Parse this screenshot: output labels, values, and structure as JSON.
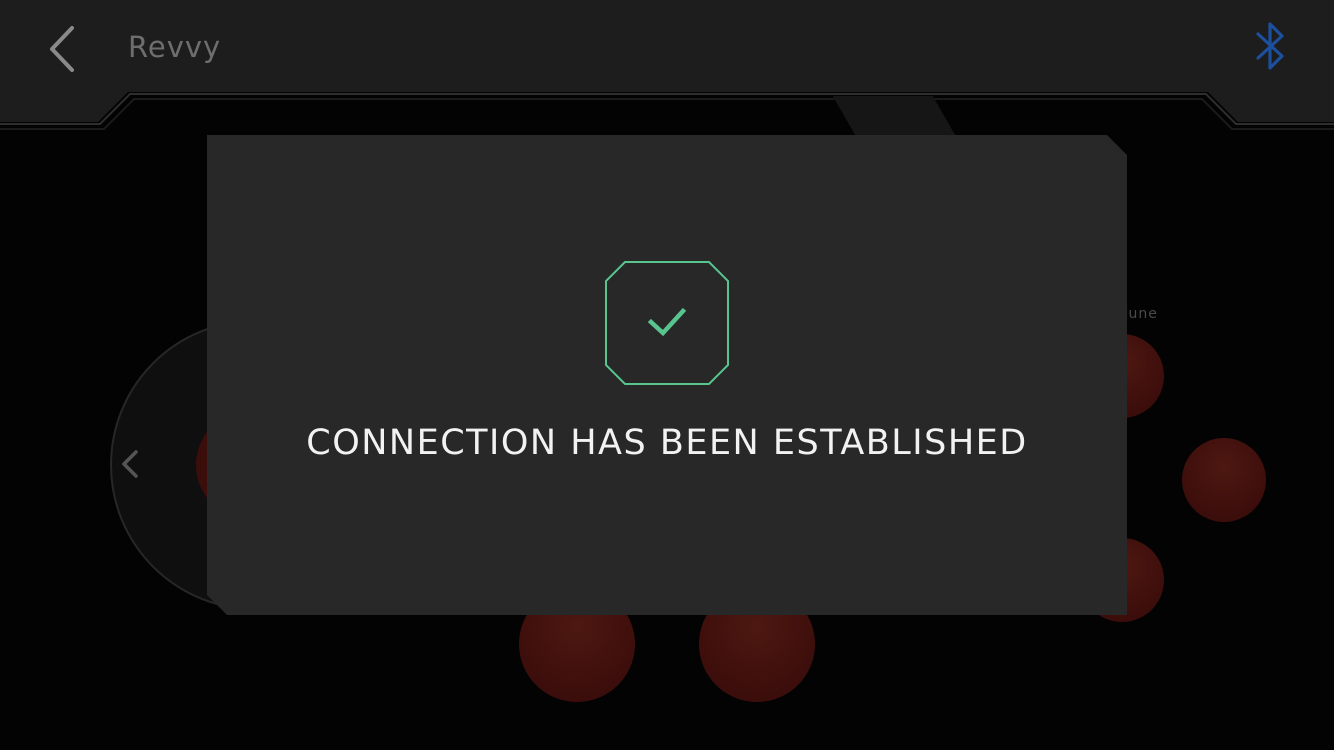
{
  "header": {
    "title": "Revvy",
    "back_icon": "chevron-left-icon",
    "bluetooth_icon": "bluetooth-icon",
    "bluetooth_color": "#1c4f9c"
  },
  "background": {
    "tune_label": "tune",
    "button_color": "#3f0f0c"
  },
  "modal": {
    "icon": "check-icon",
    "accent_color": "#58c58f",
    "message": "CONNECTION HAS BEEN ESTABLISHED"
  }
}
